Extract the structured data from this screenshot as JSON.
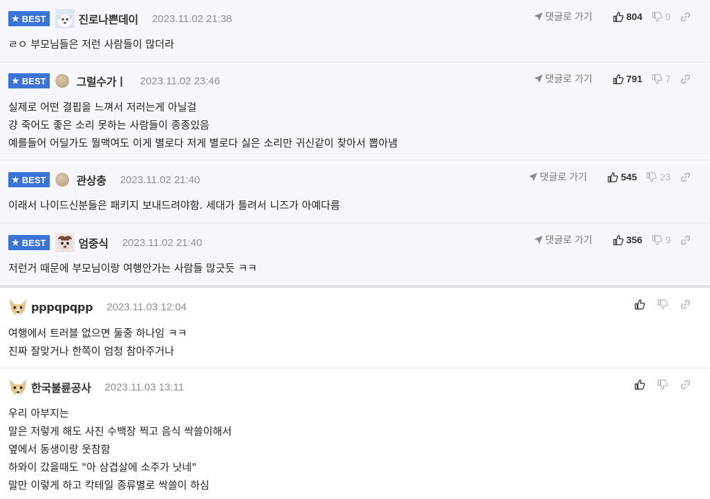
{
  "goto_label": "댓글로 가기",
  "best_label": "BEST",
  "comments": [
    {
      "nick": "진로나쁜데이",
      "time": "2023.11.02 21:38",
      "up": "804",
      "down": "9",
      "lines": [
        "ㄹㅇ 부모님들은 저런 사람들이 많더라"
      ]
    },
    {
      "nick": "그럴수가ㅣ",
      "time": "2023.11.02 23:46",
      "up": "791",
      "down": "7",
      "lines": [
        "실제로 어떤 결핍을 느껴서 저러는게 아닐걸",
        "걍 죽어도 좋은 소리 못하는 사람들이 종종있음",
        "예를들어 어딜가도 뭘맥여도 이게 별로다 저게 별로다 싫은 소리만 귀신같이 찾아서 뽑아냄"
      ]
    },
    {
      "nick": "관상충",
      "time": "2023.11.02 21:40",
      "up": "545",
      "down": "23",
      "lines": [
        "이래서 나이드신분들은 패키지 보내드려야함. 세대가 틀려서 니즈가 아예다름"
      ]
    },
    {
      "nick": "엄중식",
      "time": "2023.11.02 21:40",
      "up": "356",
      "down": "9",
      "lines": [
        "저런거 때문에 부모님이랑 여행안가는 사람들 많긋듯 ㅋㅋ"
      ]
    },
    {
      "nick": "pppqpqpp",
      "time": "2023.11.03 12:04",
      "lines": [
        "여행에서 트러블 없으면 둘중 하나임 ㅋㅋ",
        "진짜 잘맞거나 한쪽이 엄청 참아주거나"
      ]
    },
    {
      "nick": "한국불륜공사",
      "time": "2023.11.03 13:11",
      "lines": [
        "우리 아부지는",
        "말은 저렇게 해도 사진 수백장 찍고 음식 싹쓸이해서",
        "옆에서 동생이랑 웃참함",
        "하와이 갔을때도 \"아 삼겹살에 소주가 낫네\"",
        "말만 이렇게 하고 칵테일 종류별로 싹쓸이 하심"
      ]
    }
  ]
}
